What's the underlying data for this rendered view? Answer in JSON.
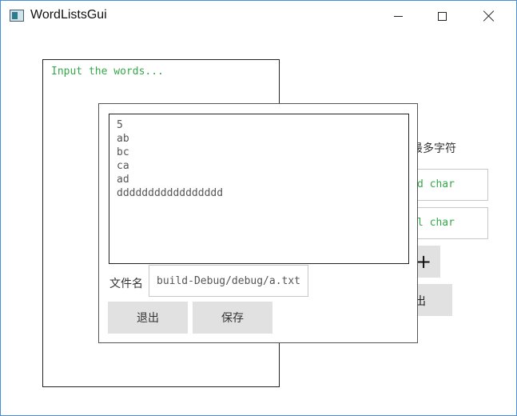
{
  "window": {
    "title": "WordListsGui",
    "icon": "app-window-icon"
  },
  "main": {
    "input_placeholder": "Input the words..."
  },
  "right_panel": {
    "label_partial": "最多字符",
    "field1_text": "d char",
    "field2_text": "l char",
    "plus_label": "+",
    "exit_label": "出"
  },
  "dialog": {
    "content_lines": [
      "5",
      "ab",
      "bc",
      "ca",
      "ad",
      "ddddddddddddddddd"
    ],
    "file_label": "文件名",
    "file_value": "build-Debug/debug/a.txt",
    "exit_label": "退出",
    "save_label": "保存"
  },
  "colors": {
    "placeholder_green": "#36a84a",
    "button_gray": "#e1e1e1",
    "window_border": "#4a8fd6"
  }
}
